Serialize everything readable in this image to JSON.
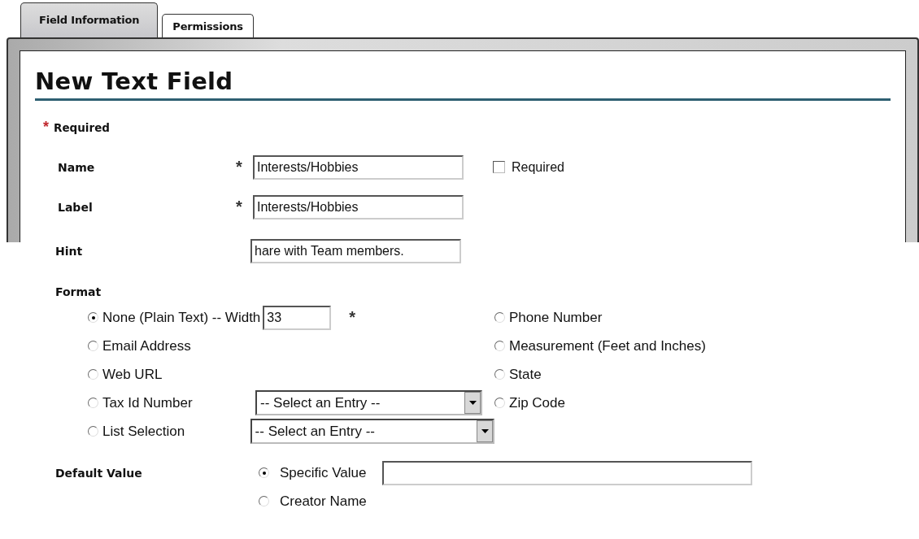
{
  "tabs": [
    {
      "label": "Field Information",
      "selected": true
    },
    {
      "label": "Permissions",
      "selected": false
    }
  ],
  "title": "New Text Field",
  "required_note": {
    "marker": "*",
    "text": "Required"
  },
  "fields": [
    {
      "label": "Name",
      "required_marker": "*",
      "value": "Interests/Hobbies",
      "checkbox": {
        "label": "Required",
        "checked": false
      }
    },
    {
      "label": "Label",
      "required_marker": "*",
      "value": "Interests/Hobbies"
    },
    {
      "label": "Hint",
      "value": "hare with Team members."
    }
  ],
  "format": {
    "label": "Format",
    "left": [
      {
        "kind": "width",
        "label": "None (Plain Text) -- Width",
        "value": "33",
        "required_marker": "*",
        "selected": true
      },
      {
        "kind": "plain",
        "label": "Email Address",
        "selected": false
      },
      {
        "kind": "plain",
        "label": "Web URL",
        "selected": false
      },
      {
        "kind": "select",
        "label": "Tax Id Number",
        "select": "-- Select an Entry --",
        "selected": false
      },
      {
        "kind": "select",
        "label": "List Selection",
        "select": "-- Select an Entry --",
        "selected": false
      }
    ],
    "right": [
      {
        "label": "Phone Number",
        "selected": false
      },
      {
        "label": "Measurement (Feet and Inches)",
        "selected": false
      },
      {
        "label": "State",
        "selected": false
      },
      {
        "label": "Zip Code",
        "selected": false
      }
    ]
  },
  "default_value": {
    "label": "Default Value",
    "options": [
      {
        "kind": "input",
        "label": "Specific Value",
        "selected": true
      },
      {
        "kind": "plain",
        "label": "Creator Name",
        "selected": false
      }
    ]
  }
}
